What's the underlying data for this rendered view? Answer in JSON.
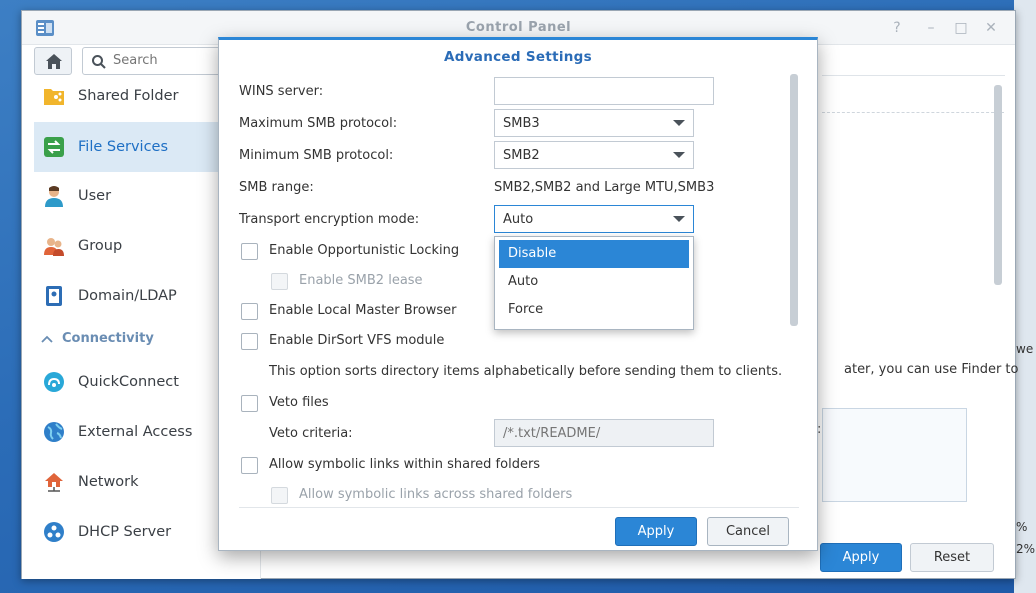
{
  "window": {
    "title": "Control Panel",
    "controls": [
      "?",
      "–",
      "□",
      "✕"
    ]
  },
  "search": {
    "placeholder": "Search"
  },
  "sidebar": {
    "items": [
      {
        "label": "Shared Folder",
        "icon": "folder-share-icon"
      },
      {
        "label": "File Services",
        "icon": "file-services-icon",
        "active": true
      },
      {
        "label": "User",
        "icon": "user-icon"
      },
      {
        "label": "Group",
        "icon": "group-icon"
      },
      {
        "label": "Domain/LDAP",
        "icon": "domain-ldap-icon"
      }
    ],
    "section_header": "Connectivity",
    "conn_items": [
      {
        "label": "QuickConnect",
        "icon": "quickconnect-icon"
      },
      {
        "label": "External Access",
        "icon": "globe-icon"
      },
      {
        "label": "Network",
        "icon": "network-house-icon"
      },
      {
        "label": "DHCP Server",
        "icon": "dhcp-icon"
      }
    ]
  },
  "background_pane": {
    "text": "ater, you can use Finder to",
    "box_colon": ":",
    "apply_label": "Apply",
    "reset_label": "Reset",
    "right_edge_text": [
      "we",
      "%",
      "2%"
    ]
  },
  "modal": {
    "title": "Advanced Settings",
    "wins_label": "WINS server:",
    "wins_value": "",
    "max_smb_label": "Maximum SMB protocol:",
    "max_smb_value": "SMB3",
    "min_smb_label": "Minimum SMB protocol:",
    "min_smb_value": "SMB2",
    "smb_range_label": "SMB range:",
    "smb_range_value": "SMB2,SMB2 and Large MTU,SMB3",
    "transport_label": "Transport encryption mode:",
    "transport_value": "Auto",
    "dropdown_options": [
      "Disable",
      "Auto",
      "Force"
    ],
    "dropdown_highlighted": "Disable",
    "opp_locking_label": "Enable Opportunistic Locking",
    "smb2_lease_label": "Enable SMB2 lease",
    "local_master_label": "Enable Local Master Browser",
    "dirsort_label": "Enable DirSort VFS module",
    "dirsort_desc": "This option sorts directory items alphabetically before sending them to clients.",
    "veto_label": "Veto files",
    "veto_criteria_label": "Veto criteria:",
    "veto_criteria_placeholder": "/*.txt/README/",
    "symlinks_label": "Allow symbolic links within shared folders",
    "symlinks_across_label": "Allow symbolic links across shared folders",
    "apply_label": "Apply",
    "cancel_label": "Cancel"
  },
  "colors": {
    "accent": "#2b86d6",
    "sidebar_active_bg": "#dbe9f5",
    "header_text": "#6a8db3"
  }
}
